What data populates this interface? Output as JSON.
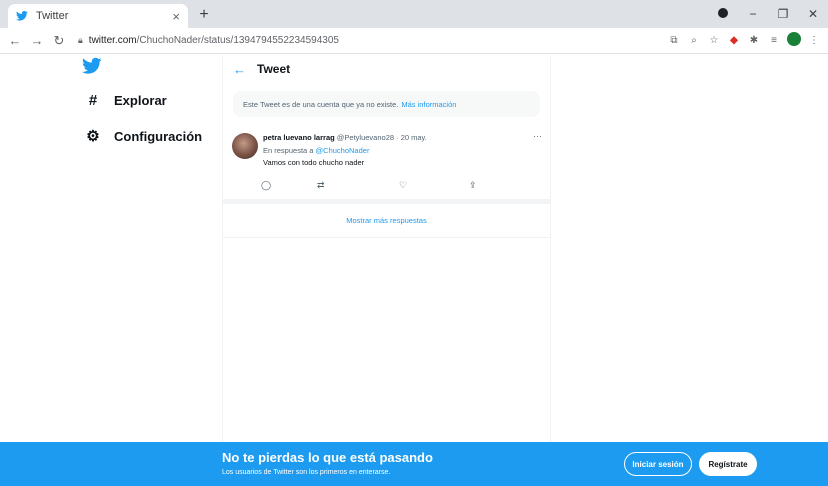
{
  "browser": {
    "tab_title": "Twitter",
    "tab_close": "×",
    "new_tab": "+",
    "url_host": "twitter.com",
    "url_path": "/ChuchoNader/status/1394794552234594305",
    "window_controls": {
      "minimize": "−",
      "restore": "❐",
      "close": "✕"
    }
  },
  "nav": {
    "items": [
      {
        "label": "Explorar",
        "icon": "hashtag-icon"
      },
      {
        "label": "Configuración",
        "icon": "gear-icon"
      }
    ]
  },
  "header": {
    "title": "Tweet"
  },
  "notice": {
    "text": "Este Tweet es de una cuenta que ya no existe.",
    "link": "Más información"
  },
  "tweet": {
    "name": "petra luevano larrag",
    "handle_date": "@Petyluevano28 · 20 may.",
    "reply_prefix": "En respuesta a",
    "mention": "@ChuchoNader",
    "text": "Vamos con todo chucho nader"
  },
  "more_replies": "Mostrar más respuestas",
  "bottom": {
    "title": "No te pierdas lo que está pasando",
    "subtitle": "Los usuarios de Twitter son los primeros en enterarse.",
    "login": "Iniciar sesión",
    "signup": "Regístrate"
  },
  "colors": {
    "accent": "#1d9bf0",
    "text_primary": "#0f1419",
    "text_secondary": "#536471",
    "chrome_bg": "#dee1e6"
  }
}
